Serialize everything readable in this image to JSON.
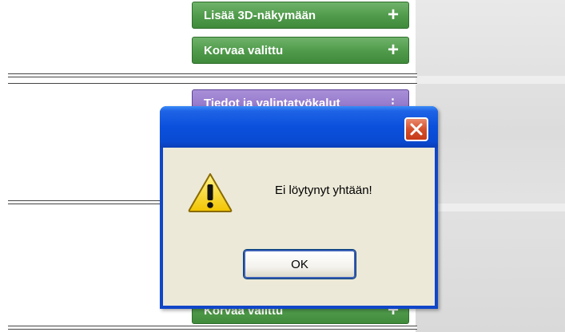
{
  "background_buttons": {
    "add_to_3d_label": "Lisää 3D-näkymään",
    "replace_selected_label": "Korvaa valittu",
    "purple_label": "Tiedot ja valintatyökalut",
    "bottom_replace_label": "Korvaa valittu"
  },
  "dialog": {
    "message": "Ei löytynyt yhtään!",
    "ok_label": "OK"
  },
  "icons": {
    "plus": "plus-icon",
    "close": "close-icon",
    "warning": "warning-icon"
  },
  "colors": {
    "green_button": "#4f9a4a",
    "purple_button": "#8a6cc4",
    "titlebar": "#0a50dc",
    "close_button": "#d4502c",
    "dialog_body": "#ece9d8"
  }
}
